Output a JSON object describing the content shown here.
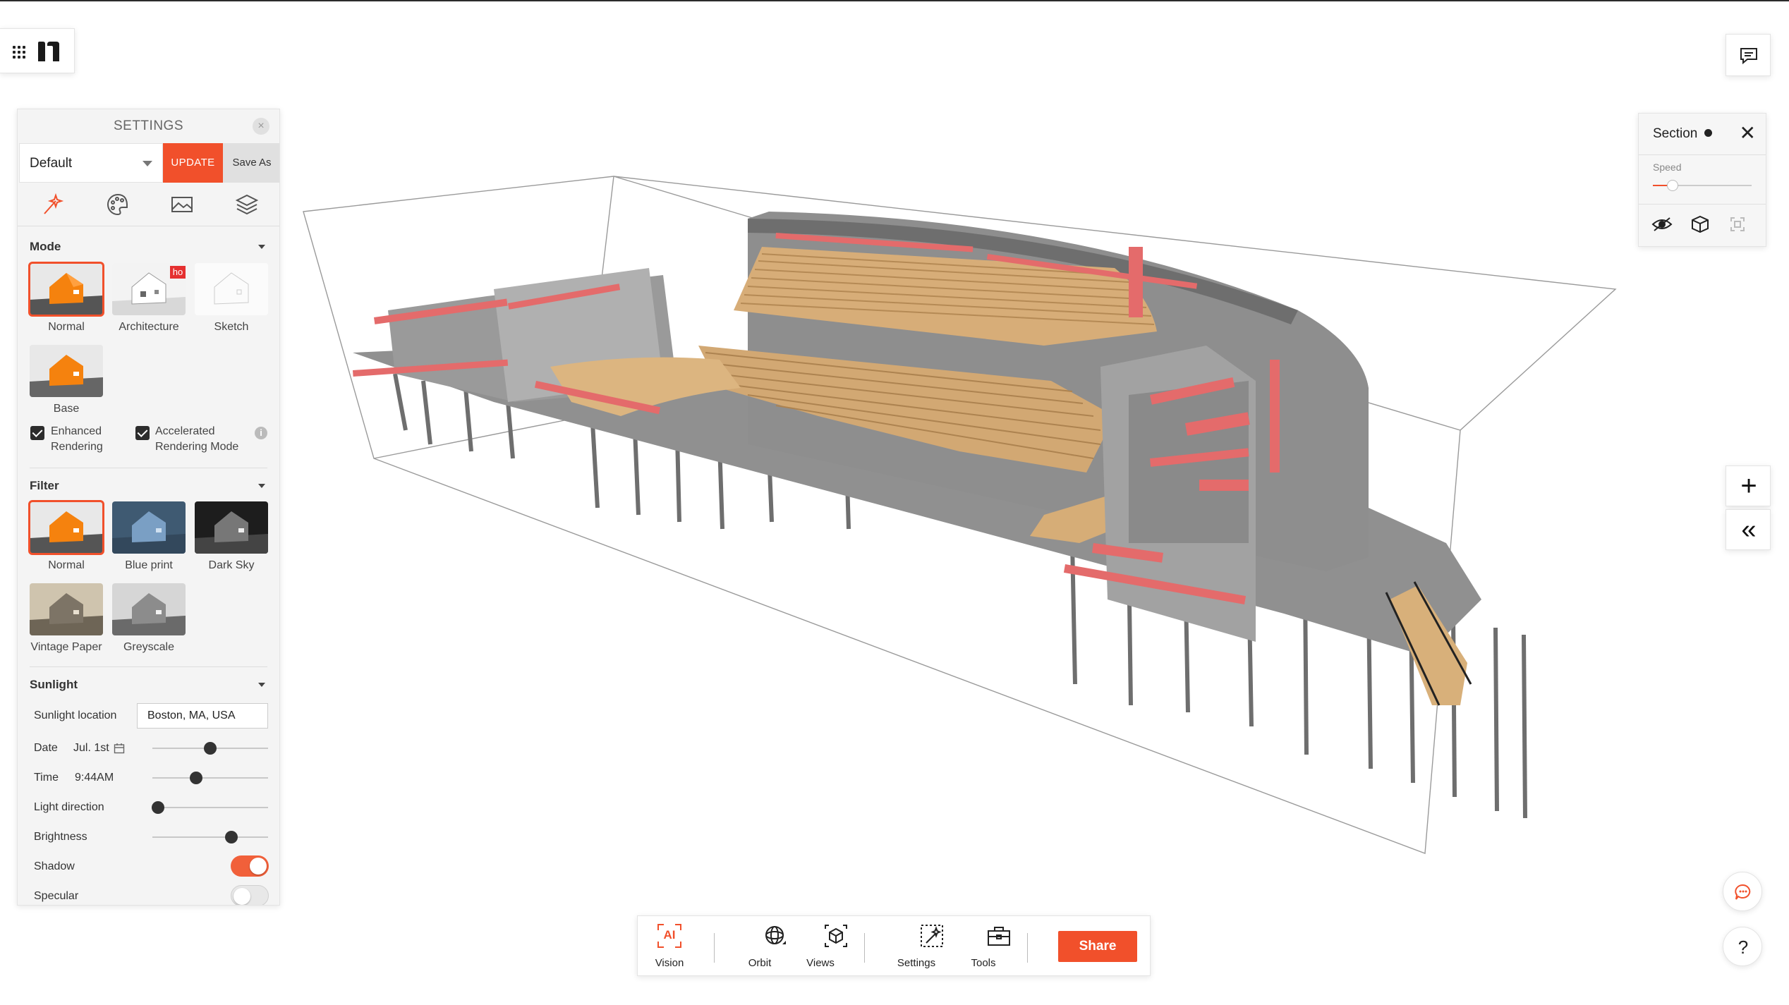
{
  "settings": {
    "title": "SETTINGS",
    "close_symbol": "×",
    "preset": "Default",
    "update_label": "UPDATE",
    "save_as_label": "Save As",
    "tabs": [
      "magic-wand-icon",
      "palette-icon",
      "landscape-icon",
      "layers-icon"
    ],
    "mode": {
      "title": "Mode",
      "items": [
        "Normal",
        "Architecture",
        "Sketch",
        "Base"
      ],
      "badge": "ho",
      "selected": "Normal"
    },
    "checkboxes": [
      {
        "label_line1": "Enhanced",
        "label_line2": "Rendering",
        "checked": true
      },
      {
        "label_line1": "Accelerated",
        "label_line2": "Rendering Mode",
        "checked": true
      }
    ],
    "info_symbol": "i",
    "filter": {
      "title": "Filter",
      "items": [
        "Normal",
        "Blue print",
        "Dark Sky",
        "Vintage Paper",
        "Greyscale"
      ],
      "selected": "Normal"
    },
    "sunlight": {
      "title": "Sunlight",
      "location_label": "Sunlight location",
      "location_value": "Boston, MA, USA",
      "date_label": "Date",
      "date_value": "Jul. 1st",
      "date_level": 0.5,
      "time_label": "Time",
      "time_value": "9:44AM",
      "time_level": 0.38,
      "light_direction_label": "Light direction",
      "light_direction_level": 0.05,
      "brightness_label": "Brightness",
      "brightness_level": 0.68,
      "shadow_label": "Shadow",
      "shadow_on": true,
      "specular_label": "Specular",
      "specular_on": false
    }
  },
  "section_panel": {
    "title": "Section",
    "speed_label": "Speed",
    "speed_level": 0.2,
    "close_symbol": "✕"
  },
  "right_buttons": {
    "plus_symbol": "+",
    "collapse_symbol": "«",
    "help_symbol": "?"
  },
  "toolbar": {
    "items": [
      {
        "label": "Vision",
        "icon": "ai-vision-icon",
        "icon_text": "AI"
      },
      {
        "label": "Orbit",
        "icon": "orbit-icon"
      },
      {
        "label": "Views",
        "icon": "cube-views-icon"
      },
      {
        "label": "Settings",
        "icon": "settings-wand-icon"
      },
      {
        "label": "Tools",
        "icon": "toolbox-icon"
      }
    ],
    "share_label": "Share"
  },
  "colors": {
    "accent": "#f1502b",
    "model_grey": "#8a8a8a",
    "wood": "#d8b07a",
    "ducts": "#e76a6a"
  }
}
